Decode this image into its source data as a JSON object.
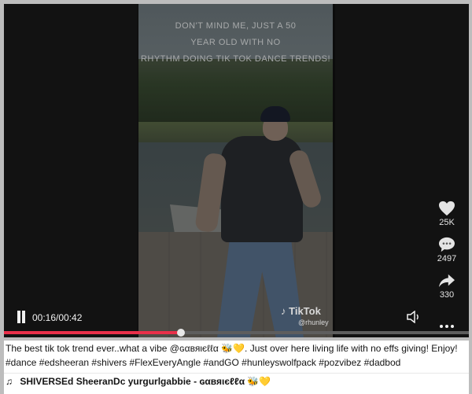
{
  "video": {
    "overlay_lines": [
      "DON'T MIND ME, JUST A 50",
      "YEAR OLD WITH NO",
      "RHYTHM DOING TIK TOK DANCE TRENDS!"
    ],
    "watermark_logo": "TikTok",
    "watermark_handle": "@rhunley"
  },
  "actions": {
    "likes": "25K",
    "comments": "2497",
    "shares": "330"
  },
  "player": {
    "time": "00:16/00:42",
    "progress_fraction": 0.381
  },
  "caption": {
    "description": "The best tik tok trend ever..what a vibe @ɢαвяιєℓℓα 🐝💛. Just over here living life with no effs giving! Enjoy!",
    "hashtags": "#dance #edsheeran #shivers #FlexEveryAngle #andGO #hunleyswolfpack #pozvibez #dadbod",
    "music_note": "♫",
    "music": "SHIVERSEd SheeranDc yurgurlgabbie - ɢαвяιєℓℓα 🐝💛"
  },
  "colors": {
    "progress": "#e9304a",
    "background": "#bdbdbd"
  }
}
